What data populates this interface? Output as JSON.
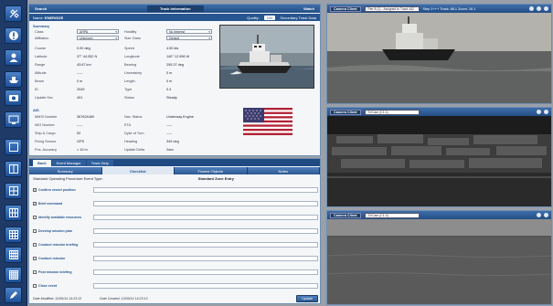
{
  "track_panel": {
    "left_title": "Search",
    "center_title": "Track Information",
    "right_title": "Watch",
    "name_label": "Name:",
    "name_value": "ENERGIZE",
    "quality_label": "Quality:",
    "quality_value": "120",
    "secondary_label": "Secondary Track Data",
    "summary_heading": "Summary",
    "dropdowns": {
      "class_label": "Class",
      "class_value": "ARPA",
      "hostility_label": "Hostility",
      "hostility_value": "No Interest",
      "affiliation_label": "Affiliation",
      "affiliation_value": "Unknown",
      "size_label": "Size Class",
      "size_value": "Default"
    },
    "fields_left": [
      {
        "label": "Course",
        "value": "0.00 deg"
      },
      {
        "label": "Latitude",
        "value": "37° 44.052 N"
      },
      {
        "label": "Range",
        "value": "43.67 km"
      },
      {
        "label": "Altitude",
        "value": "-----"
      },
      {
        "label": "Beam",
        "value": "0 m"
      },
      {
        "label": "ID",
        "value": "2049"
      },
      {
        "label": "Update Sec",
        "value": "401"
      }
    ],
    "fields_right": [
      {
        "label": "Speed",
        "value": "4.50 kts"
      },
      {
        "label": "Longitude",
        "value": "140° 12.998 W"
      },
      {
        "label": "Bearing",
        "value": "295.37 deg"
      },
      {
        "label": "Uncertainty",
        "value": "0 m"
      },
      {
        "label": "Length",
        "value": "0 m"
      },
      {
        "label": "Type",
        "value": "0.4"
      },
      {
        "label": "Status",
        "value": "Steady"
      }
    ],
    "ais_heading": "AIS",
    "ais_left": [
      {
        "label": "MMSI Number",
        "value": "367624480"
      },
      {
        "label": "IMO Number",
        "value": "-----"
      },
      {
        "label": "Ship & Cargo",
        "value": "52"
      },
      {
        "label": "Fixing Sensor",
        "value": "GPS"
      },
      {
        "label": "Pos. Accuracy",
        "value": "> 10 m"
      }
    ],
    "ais_right": [
      {
        "label": "Nav. Status",
        "value": "Underway Engine"
      },
      {
        "label": "ETA",
        "value": "-----"
      },
      {
        "label": "Dyke of Turn",
        "value": "-----"
      },
      {
        "label": "Heading",
        "value": "349 deg"
      },
      {
        "label": "Update Delta",
        "value": "2sec"
      }
    ]
  },
  "sops_panel": {
    "tabs": [
      "Back",
      "Event Manager",
      "Track Help"
    ],
    "sub_tabs": [
      "Summary",
      "Checklist",
      "Flowed Objects",
      "Notes"
    ],
    "procedure_label": "Standard Operating Procedure Event Type:",
    "procedure_value": "Standard Zone Entry",
    "tasks": [
      {
        "label": "Confirm vessel position",
        "checked": "✓"
      },
      {
        "label": "Brief command",
        "checked": "✓"
      },
      {
        "label": "Identify available resources",
        "checked": ""
      },
      {
        "label": "Develop mission plan",
        "checked": ""
      },
      {
        "label": "Conduct mission briefing",
        "checked": ""
      },
      {
        "label": "Conduct mission",
        "checked": ""
      },
      {
        "label": "Post mission briefing",
        "checked": ""
      },
      {
        "label": "Close event",
        "checked": ""
      }
    ],
    "date_modified": "Date Modified: 12/09/14 14:23:13",
    "date_created": "Date Created: 12/09/14 14:23:13",
    "update_button": "Update"
  },
  "cameras": [
    {
      "tag": "Camera Client",
      "source": "Pier 8 (1) - Assigned to Track 442",
      "extra": "Step 1+++  Track: 88.1  Zoom: 16.1"
    },
    {
      "tag": "Camera Client",
      "source": "SVCam (C1-1)",
      "extra": ""
    },
    {
      "tag": "Camera Client",
      "source": "SVCam (C1-3)",
      "extra": ""
    }
  ]
}
